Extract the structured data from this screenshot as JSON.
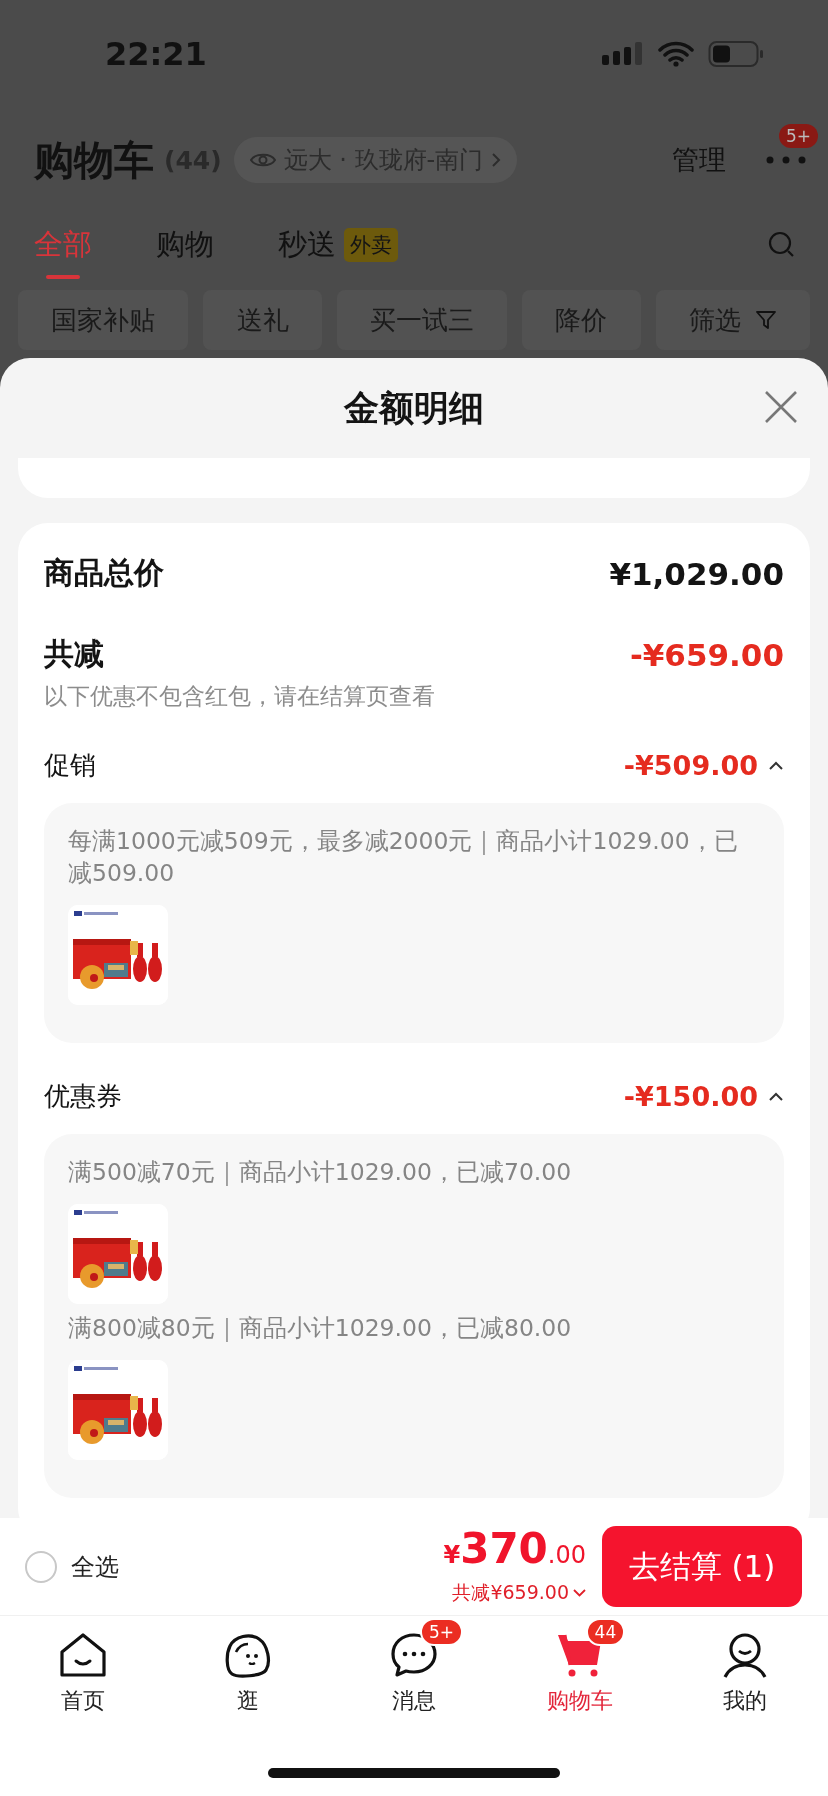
{
  "status_bar": {
    "time": "22:21"
  },
  "header": {
    "title": "购物车",
    "count": "(44)",
    "location": "远大 · 玖珑府-南门",
    "manage": "管理",
    "more_badge": "5+"
  },
  "tabs": [
    {
      "label": "全部",
      "selected": true
    },
    {
      "label": "购物",
      "selected": false
    },
    {
      "label": "秒送",
      "badge": "外卖",
      "selected": false
    }
  ],
  "filters": [
    {
      "label": "国家补贴",
      "kind": "chip"
    },
    {
      "label": "送礼",
      "kind": "chip"
    },
    {
      "label": "买一试三",
      "kind": "chip"
    },
    {
      "label": "降价",
      "kind": "chip"
    },
    {
      "label": "筛选",
      "kind": "filter"
    }
  ],
  "sheet": {
    "title": "金额明细",
    "total_label": "商品总价",
    "total_value": "¥1,029.00",
    "discount_label": "共减",
    "discount_value": "-¥659.00",
    "note": "以下优惠不包含红包，请在结算页查看",
    "sections": [
      {
        "title": "促销",
        "amount": "-¥509.00",
        "expanded": true,
        "rules": [
          {
            "text": "每满1000元减509元，最多减2000元｜商品小计1029.00，已减509.00"
          }
        ]
      },
      {
        "title": "优惠券",
        "amount": "-¥150.00",
        "expanded": true,
        "rules": [
          {
            "text": "满500减70元｜商品小计1029.00，已减70.00"
          },
          {
            "text": "满800减80元｜商品小计1029.00，已减80.00"
          }
        ]
      }
    ]
  },
  "bottom_bar": {
    "select_all": {
      "label": "全选",
      "checked": false
    },
    "price": {
      "symbol": "¥",
      "integer": "370",
      "decimals": ".00"
    },
    "discount": "共减¥659.00",
    "checkout": "去结算 (1)"
  },
  "nav": [
    {
      "label": "首页",
      "kind": "home",
      "selected": false
    },
    {
      "label": "逛",
      "kind": "browse",
      "selected": false
    },
    {
      "label": "消息",
      "kind": "message",
      "badge": "5+",
      "selected": false
    },
    {
      "label": "购物车",
      "kind": "cart",
      "badge": "44",
      "selected": true
    },
    {
      "label": "我的",
      "kind": "profile",
      "selected": false
    }
  ]
}
